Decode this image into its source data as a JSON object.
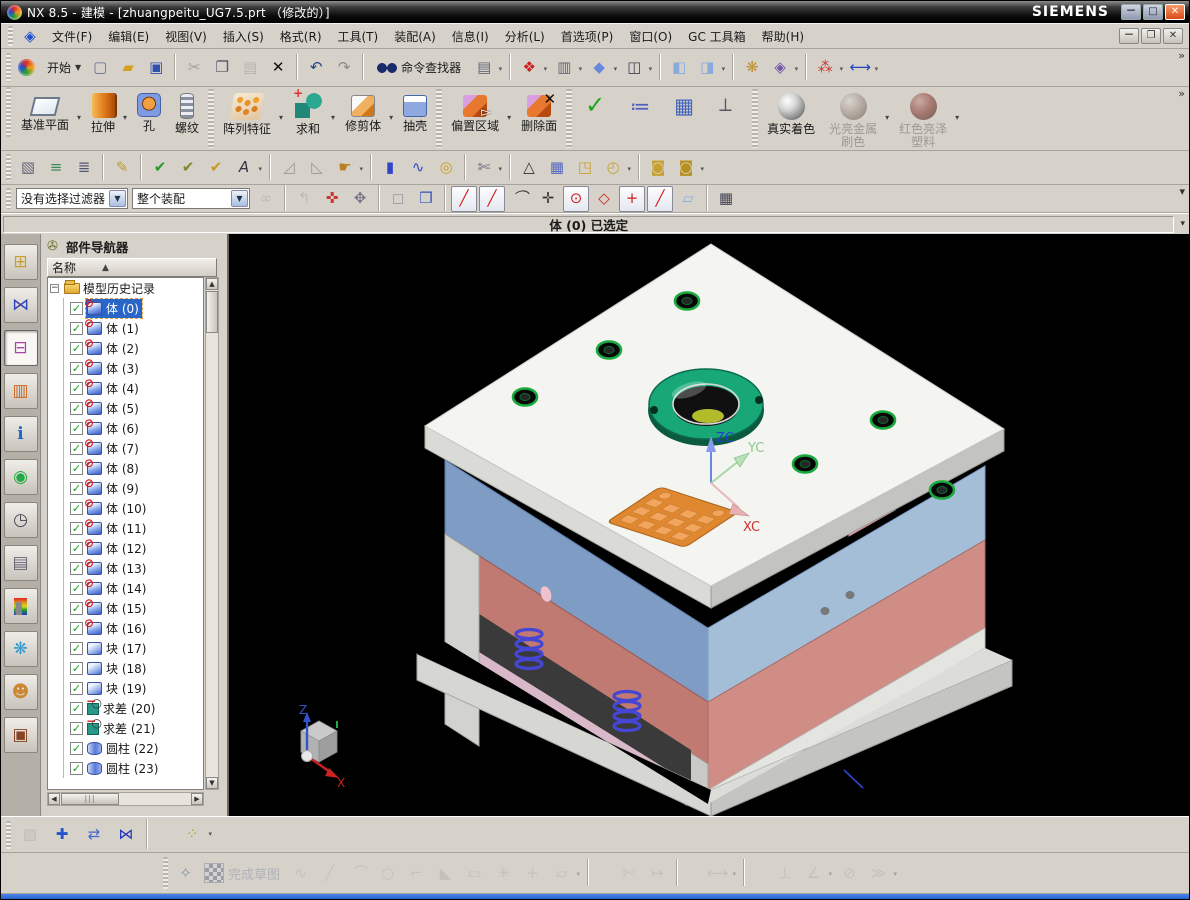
{
  "window": {
    "title": "NX 8.5 - 建模 - [zhuangpeitu_UG7.5.prt （修改的）]",
    "brand": "SIEMENS",
    "buttons": {
      "minimize": "－",
      "maximize": "□",
      "close": "✕"
    }
  },
  "menubar": {
    "items": [
      "文件(F)",
      "编辑(E)",
      "视图(V)",
      "插入(S)",
      "格式(R)",
      "工具(T)",
      "装配(A)",
      "信息(I)",
      "分析(L)",
      "首选项(P)",
      "窗口(O)",
      "GC 工具箱",
      "帮助(H)"
    ]
  },
  "toolbar_main": {
    "start_label": "开始",
    "finder_label": "命令查找器",
    "icons_a": [
      {
        "name": "new-file"
      },
      {
        "name": "open"
      },
      {
        "name": "save"
      },
      {
        "sep": true
      },
      {
        "name": "cut",
        "disabled": true
      },
      {
        "name": "copy"
      },
      {
        "name": "paste",
        "disabled": true
      },
      {
        "name": "delete"
      },
      {
        "sep": true
      },
      {
        "name": "undo"
      },
      {
        "name": "redo"
      },
      {
        "sep": true
      }
    ],
    "icons_b": [
      {
        "name": "print",
        "arrow": true
      },
      {
        "sep": true
      },
      {
        "name": "fit-view",
        "arrow": true
      },
      {
        "name": "render-style",
        "arrow": true
      },
      {
        "name": "shaded-cube",
        "arrow": true
      },
      {
        "name": "view-layout",
        "arrow": true
      },
      {
        "sep": true
      },
      {
        "name": "edit-section"
      },
      {
        "name": "new-section",
        "arrow": true
      },
      {
        "sep": true
      },
      {
        "name": "art-palette"
      },
      {
        "name": "appearance",
        "arrow": true
      },
      {
        "sep": true
      },
      {
        "name": "interpart-link",
        "arrow": true
      },
      {
        "name": "measure",
        "arrow": true
      }
    ]
  },
  "features": {
    "buttons": [
      {
        "name": "datum-plane",
        "label": "基准平面",
        "arrow": true
      },
      {
        "name": "extrude",
        "label": "拉伸",
        "arrow": true
      },
      {
        "name": "hole",
        "label": "孔"
      },
      {
        "name": "thread",
        "label": "螺纹"
      },
      {
        "sep": true
      },
      {
        "name": "pattern-feature",
        "label": "阵列特征",
        "arrow": true
      },
      {
        "name": "unite",
        "label": "求和",
        "arrow": true
      },
      {
        "name": "trim-body",
        "label": "修剪体",
        "arrow": true
      },
      {
        "name": "shell",
        "label": "抽壳"
      },
      {
        "sep": true
      },
      {
        "name": "offset-region",
        "label": "偏置区域",
        "arrow": true
      },
      {
        "name": "delete-face",
        "label": "删除面"
      },
      {
        "sep": true
      },
      {
        "name": "green-check",
        "label": ""
      },
      {
        "name": "feature-list",
        "label": ""
      },
      {
        "name": "spreadsheet",
        "label": ""
      },
      {
        "name": "csys",
        "label": ""
      },
      {
        "sep": true
      },
      {
        "name": "true-shading",
        "label": "真实着色"
      },
      {
        "name": "bright-metal",
        "label": "光亮金属\n刷色",
        "arrow": true,
        "disabled": true
      },
      {
        "name": "red-plastic",
        "label": "红色亮泽\n塑料",
        "arrow": true,
        "disabled": true
      }
    ]
  },
  "row3": {
    "icons": [
      {
        "name": "select-rect"
      },
      {
        "name": "layer-stack"
      },
      {
        "name": "layer-settings"
      },
      {
        "sep": true
      },
      {
        "name": "note-tag"
      },
      {
        "sep": true
      },
      {
        "name": "body-check"
      },
      {
        "name": "tool-check"
      },
      {
        "name": "block-check"
      },
      {
        "name": "abc-note",
        "arrow": true
      },
      {
        "sep": true
      },
      {
        "name": "draft-1"
      },
      {
        "name": "draft-2"
      },
      {
        "name": "pick-hand",
        "arrow": true
      },
      {
        "sep": true
      },
      {
        "name": "cylinder-blue"
      },
      {
        "name": "spring"
      },
      {
        "name": "washer"
      },
      {
        "sep": true
      },
      {
        "name": "unclip",
        "arrow": true
      },
      {
        "sep": true
      },
      {
        "name": "triangle"
      },
      {
        "name": "table-triangle"
      },
      {
        "name": "folder-points"
      },
      {
        "name": "folder-circles",
        "arrow": true
      },
      {
        "sep": true
      },
      {
        "name": "lock-1"
      },
      {
        "name": "lock-2",
        "arrow": true
      }
    ]
  },
  "selbar": {
    "filter_value": "没有选择过滤器",
    "scope_value": "整个装配",
    "icons": [
      {
        "name": "binoc-gray",
        "disabled": true
      },
      {
        "sep": true
      },
      {
        "name": "arrow-gray",
        "disabled": true
      },
      {
        "name": "target-red"
      },
      {
        "name": "hand-key"
      },
      {
        "sep": true
      },
      {
        "name": "cube-white"
      },
      {
        "name": "book-blue"
      },
      {
        "sep": true
      },
      {
        "name": "snap-endpoint",
        "boxed": true
      },
      {
        "name": "snap-midpoint",
        "boxed": true
      },
      {
        "name": "snap-curve"
      },
      {
        "name": "snap-intersection"
      },
      {
        "name": "snap-center",
        "boxed": true
      },
      {
        "name": "snap-quadrant"
      },
      {
        "name": "snap-point",
        "boxed": true
      },
      {
        "name": "snap-on-curve",
        "boxed": true
      },
      {
        "name": "snap-on-face"
      },
      {
        "sep": true
      },
      {
        "name": "grid"
      }
    ]
  },
  "prompt": {
    "text": "体 (0)  已选定"
  },
  "navigator": {
    "title": "部件导航器",
    "column": "名称",
    "root_label": "模型历史记录",
    "items": [
      {
        "label": "体 (0)",
        "icon": "body",
        "selected": true
      },
      {
        "label": "体 (1)",
        "icon": "body"
      },
      {
        "label": "体 (2)",
        "icon": "body"
      },
      {
        "label": "体 (3)",
        "icon": "body"
      },
      {
        "label": "体 (4)",
        "icon": "body"
      },
      {
        "label": "体 (5)",
        "icon": "body"
      },
      {
        "label": "体 (6)",
        "icon": "body"
      },
      {
        "label": "体 (7)",
        "icon": "body"
      },
      {
        "label": "体 (8)",
        "icon": "body"
      },
      {
        "label": "体 (9)",
        "icon": "body"
      },
      {
        "label": "体 (10)",
        "icon": "body"
      },
      {
        "label": "体 (11)",
        "icon": "body"
      },
      {
        "label": "体 (12)",
        "icon": "body"
      },
      {
        "label": "体 (13)",
        "icon": "body"
      },
      {
        "label": "体 (14)",
        "icon": "body"
      },
      {
        "label": "体 (15)",
        "icon": "body"
      },
      {
        "label": "体 (16)",
        "icon": "body"
      },
      {
        "label": "块 (17)",
        "icon": "block"
      },
      {
        "label": "块 (18)",
        "icon": "block"
      },
      {
        "label": "块 (19)",
        "icon": "block"
      },
      {
        "label": "求差 (20)",
        "icon": "subtract"
      },
      {
        "label": "求差 (21)",
        "icon": "subtract"
      },
      {
        "label": "圆柱 (22)",
        "icon": "cylinder"
      },
      {
        "label": "圆柱 (23)",
        "icon": "cylinder"
      }
    ]
  },
  "resource": {
    "items": [
      {
        "name": "assembly-navigator"
      },
      {
        "name": "constraint-navigator"
      },
      {
        "name": "part-navigator",
        "active": true
      },
      {
        "name": "reuse-library"
      },
      {
        "name": "web-browser"
      },
      {
        "name": "history-palette"
      },
      {
        "name": "history-clock"
      },
      {
        "name": "process-studio"
      },
      {
        "name": "visualization"
      },
      {
        "name": "visual-effects"
      },
      {
        "name": "roles"
      },
      {
        "name": "system-scenes"
      }
    ]
  },
  "viewport": {
    "wcs": {
      "z": "ZC",
      "y": "YC",
      "x": "XC"
    },
    "triad": {
      "z": "Z",
      "x": "X"
    }
  },
  "bottombar": {
    "icons": [
      {
        "name": "thumb",
        "disabled": true
      },
      {
        "name": "add-component"
      },
      {
        "name": "move-component"
      },
      {
        "name": "assembly-constraints"
      },
      {
        "sep": true
      },
      {
        "name": "pattern-component",
        "arrow": true
      }
    ]
  },
  "sketchbar": {
    "finish_label": "完成草图",
    "icons": [
      {
        "name": "profile",
        "disabled": true
      },
      {
        "name": "line",
        "disabled": true
      },
      {
        "name": "arc",
        "disabled": true
      },
      {
        "name": "circle",
        "disabled": true
      },
      {
        "name": "fillet",
        "disabled": true
      },
      {
        "name": "chamfer",
        "disabled": true
      },
      {
        "name": "rectangle",
        "disabled": true
      },
      {
        "name": "polyline",
        "disabled": true
      },
      {
        "name": "point-plus",
        "disabled": true
      },
      {
        "name": "offset-pattern",
        "disabled": true,
        "arrow": true
      },
      {
        "sep": true
      },
      {
        "name": "quick-trim",
        "disabled": true
      },
      {
        "name": "quick-extend",
        "disabled": true
      },
      {
        "sep": true
      },
      {
        "name": "rapid-dim",
        "disabled": true,
        "arrow": true
      },
      {
        "sep": true
      },
      {
        "name": "perpendicular",
        "disabled": true
      },
      {
        "name": "angle",
        "disabled": true,
        "arrow": true
      },
      {
        "name": "constraint-circle",
        "disabled": true
      },
      {
        "name": "more",
        "disabled": true,
        "arrow": true
      }
    ]
  },
  "colors": {
    "selection": "#2a65c8",
    "viewport_bg": "#000000",
    "plate_blue": "#7e9cc4",
    "plate_red": "#c17a72",
    "ring_green": "#18a878",
    "spring_blue": "#4646d4",
    "part_orange": "#e08830"
  }
}
